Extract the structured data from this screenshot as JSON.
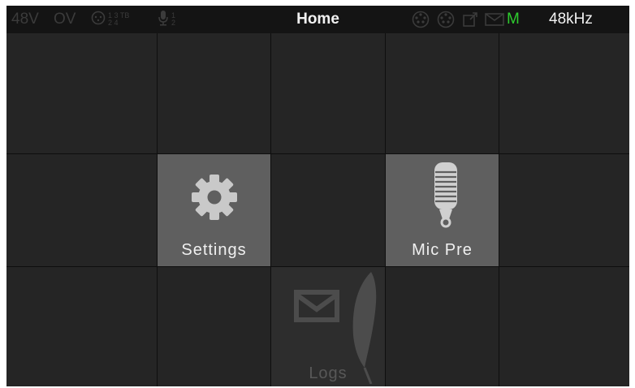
{
  "status_bar": {
    "phantom_power": "48V",
    "overvoltage": "OV",
    "input_digits_top": "1 3 TB",
    "input_digits_bottom": "2 4",
    "mic_digits_top": "1",
    "mic_digits_bottom": "2",
    "title": "Home",
    "mode_indicator": "M",
    "sample_rate": "48kHz",
    "colors": {
      "active_text": "#f2f2f2",
      "dim_text": "#3b3b3b",
      "mode_green": "#2ecc2e"
    }
  },
  "tiles": {
    "settings_label": "Settings",
    "mic_pre_label": "Mic Pre",
    "logs_label": "Logs"
  }
}
